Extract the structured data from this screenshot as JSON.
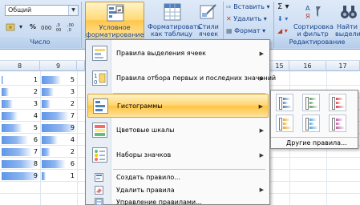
{
  "ribbon": {
    "number_group": {
      "format_value": "Общий",
      "caption": "Число"
    },
    "conditional_formatting": {
      "line1": "Условное",
      "line2": "форматирование"
    },
    "format_as_table": {
      "line1": "Форматировать",
      "line2": "как таблицу"
    },
    "cell_styles": {
      "line1": "Стили",
      "line2": "ячеек"
    },
    "cells_group": {
      "insert": "Вставить",
      "delete": "Удалить",
      "format": "Формат"
    },
    "editing_group": {
      "sort_filter_line1": "Сортировка",
      "sort_filter_line2": "и фильтр",
      "find_select_line1": "Найти",
      "find_select_line2": "выдели",
      "caption": "Редактирование"
    }
  },
  "sheet": {
    "columns": [
      "8",
      "9",
      "",
      "",
      "",
      "",
      "",
      "",
      "15",
      "16",
      "17"
    ],
    "rows": [
      {
        "a": 1,
        "b": 5,
        "bar_a": 0.05,
        "bar_b": 0.55
      },
      {
        "a": 2,
        "b": 3,
        "bar_a": 0.18,
        "bar_b": 0.35
      },
      {
        "a": 3,
        "b": 2,
        "bar_a": 0.3,
        "bar_b": 0.25
      },
      {
        "a": 4,
        "b": 7,
        "bar_a": 0.42,
        "bar_b": 0.78
      },
      {
        "a": 5,
        "b": 9,
        "bar_a": 0.55,
        "bar_b": 1.0
      },
      {
        "a": 6,
        "b": 4,
        "bar_a": 0.68,
        "bar_b": 0.45
      },
      {
        "a": 7,
        "b": 2,
        "bar_a": 0.8,
        "bar_b": 0.25
      },
      {
        "a": 8,
        "b": 6,
        "bar_a": 0.9,
        "bar_b": 0.68
      },
      {
        "a": 9,
        "b": 1,
        "bar_a": 1.0,
        "bar_b": 0.12
      }
    ]
  },
  "menu": {
    "highlight_rules": "Правила выделения ячеек",
    "top_bottom_rules": "Правила отбора первых и последних значений",
    "data_bars": "Гистограммы",
    "color_scales": "Цветовые шкалы",
    "icon_sets": "Наборы значков",
    "new_rule": "Создать правило...",
    "clear_rules": "Удалить правила",
    "manage_rules": "Управление правилами..."
  },
  "submenu": {
    "more_rules": "Другие правила...",
    "swatch_colors": [
      "#4f81bd",
      "#5aa05a",
      "#d9434b",
      "#f5a623",
      "#4aa3df",
      "#c55aa7"
    ]
  }
}
